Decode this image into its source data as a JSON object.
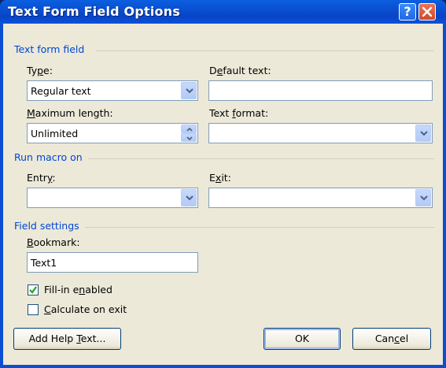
{
  "window": {
    "title": "Text Form Field Options",
    "help_glyph": "?",
    "close_glyph": "X"
  },
  "groups": {
    "text_form_field": "Text form field",
    "run_macro_on": "Run macro on",
    "field_settings": "Field settings"
  },
  "fields": {
    "type": {
      "label_pre": "Ty",
      "label_key": "p",
      "label_post": "e:",
      "value": "Regular text"
    },
    "default_text": {
      "label_pre": "D",
      "label_key": "e",
      "label_post": "fault text:",
      "value": ""
    },
    "max_length": {
      "label_pre": "",
      "label_key": "M",
      "label_post": "aximum length:",
      "value": "Unlimited"
    },
    "text_format": {
      "label_pre": "Text ",
      "label_key": "f",
      "label_post": "ormat:",
      "value": ""
    },
    "entry": {
      "label_pre": "Entr",
      "label_key": "y",
      "label_post": ":",
      "value": ""
    },
    "exit": {
      "label_pre": "E",
      "label_key": "x",
      "label_post": "it:",
      "value": ""
    },
    "bookmark": {
      "label_pre": "",
      "label_key": "B",
      "label_post": "ookmark:",
      "value": "Text1"
    }
  },
  "checkboxes": {
    "fill_in": {
      "label_pre": "Fill-in e",
      "label_key": "n",
      "label_post": "abled",
      "checked": true
    },
    "calculate": {
      "label_pre": "",
      "label_key": "C",
      "label_post": "alculate on exit",
      "checked": false
    }
  },
  "buttons": {
    "help_text": {
      "pre": "Add Help ",
      "key": "T",
      "post": "ext..."
    },
    "ok": "OK",
    "cancel": {
      "pre": "Can",
      "key": "c",
      "post": "el"
    }
  },
  "colors": {
    "title_bar": "#0a4fd1",
    "group_label": "#0046d5",
    "dialog_bg": "#ece9d8",
    "check": "#21a121"
  },
  "icons": {
    "dropdown": "chevron-down-icon",
    "spinner": "spinner-arrows-icon",
    "check": "check-icon"
  }
}
